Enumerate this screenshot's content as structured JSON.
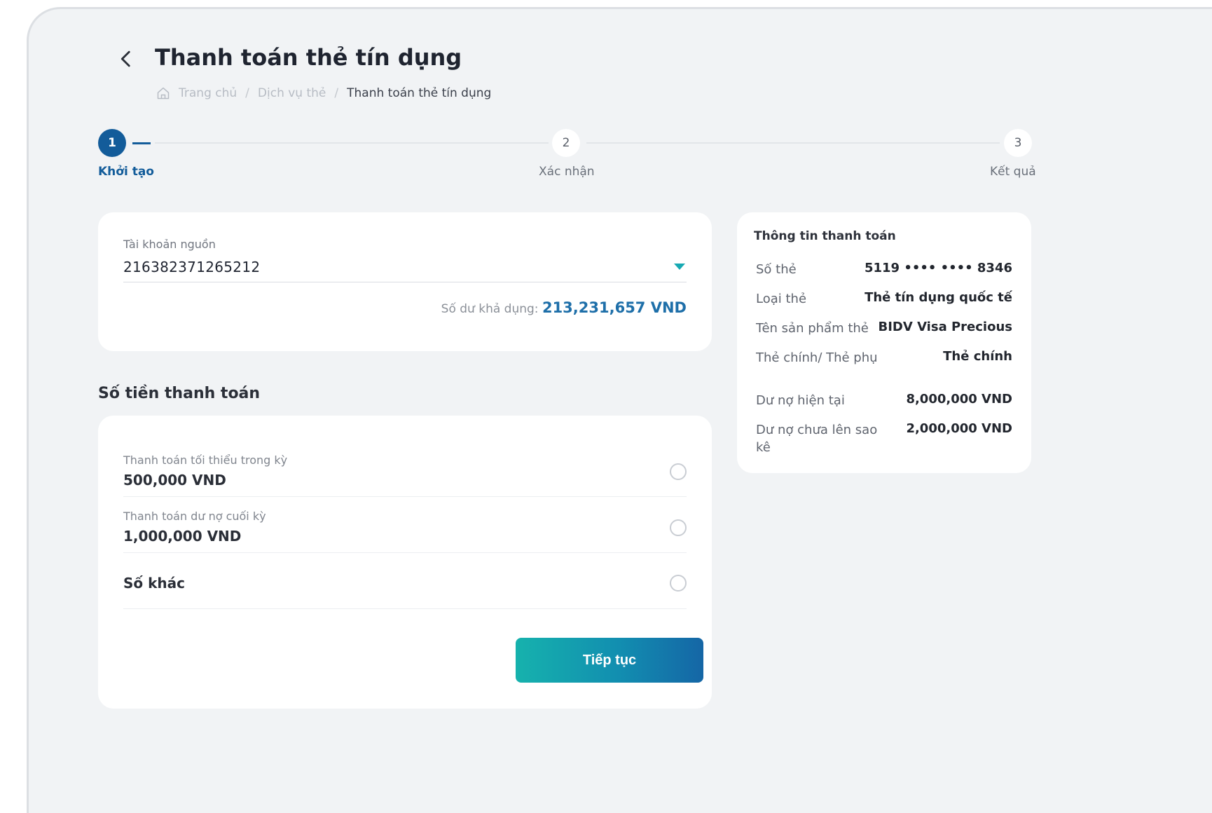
{
  "header": {
    "title": "Thanh toán thẻ tín dụng",
    "breadcrumb": [
      "Trang chủ",
      "Dịch vụ thẻ",
      "Thanh toán thẻ tín dụng"
    ],
    "separator": "/"
  },
  "stepper": {
    "steps": [
      {
        "number": "1",
        "label": "Khởi tạo",
        "state": "active"
      },
      {
        "number": "2",
        "label": "Xác nhận",
        "state": "todo"
      },
      {
        "number": "3",
        "label": "Kết quả",
        "state": "todo"
      }
    ]
  },
  "source_account": {
    "label": "Tài khoản nguồn",
    "value": "216382371265212",
    "balance_label": "Số dư khả dụng:",
    "balance_value": "213,231,657 VND"
  },
  "payment_amount": {
    "section_title": "Số tiền thanh toán",
    "options": [
      {
        "label": "Thanh toán tối thiểu trong kỳ",
        "value": "500,000 VND"
      },
      {
        "label": "Thanh toán dư nợ cuối kỳ",
        "value": "1,000,000 VND"
      },
      {
        "label": "",
        "value": "Số khác"
      }
    ],
    "continue_label": "Tiếp tục"
  },
  "payment_info": {
    "title": "Thông tin thanh toán",
    "rows": [
      {
        "key": "Số thẻ",
        "value": "5119 •••• •••• 8346"
      },
      {
        "key": "Loại thẻ",
        "value": "Thẻ tín dụng quốc tế"
      },
      {
        "key": "Tên sản phẩm thẻ",
        "value": "BIDV Visa Precious"
      },
      {
        "key": "Thẻ chính/ Thẻ phụ",
        "value": "Thẻ chính"
      },
      {
        "key": "Dư nợ hiện tại",
        "value": "8,000,000 VND"
      },
      {
        "key": "Dư nợ chưa lên sao kê",
        "value": "2,000,000 VND"
      }
    ]
  },
  "colors": {
    "primary": "#135c9a",
    "accent": "#17a9b3",
    "balance": "#1e6fa9"
  }
}
